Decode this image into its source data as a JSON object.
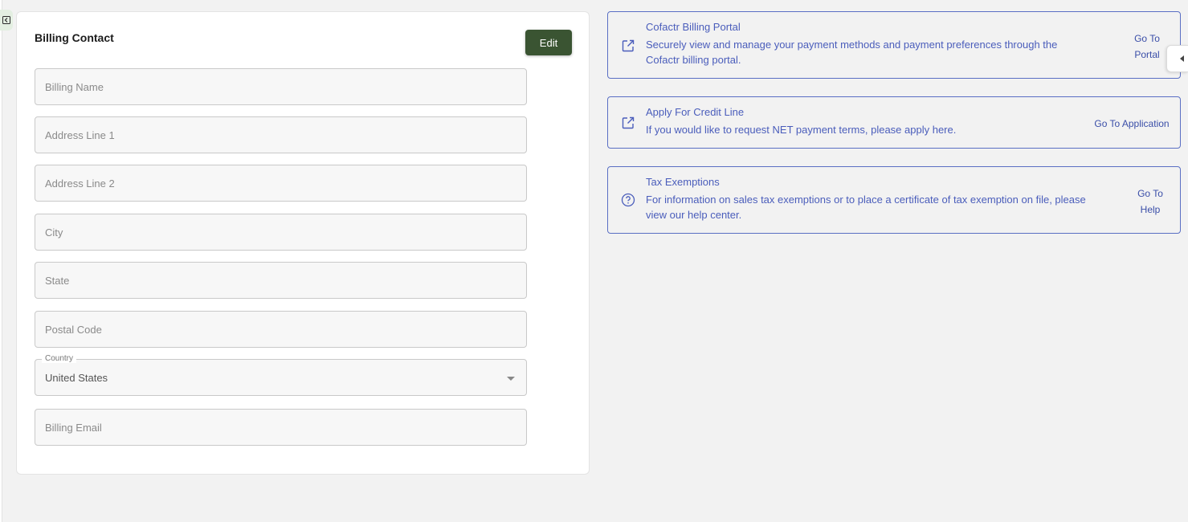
{
  "billing_contact": {
    "title": "Billing Contact",
    "edit_label": "Edit",
    "fields": {
      "billing_name": {
        "placeholder": "Billing Name",
        "value": ""
      },
      "address_line_1": {
        "placeholder": "Address Line 1",
        "value": ""
      },
      "address_line_2": {
        "placeholder": "Address Line 2",
        "value": ""
      },
      "city": {
        "placeholder": "City",
        "value": ""
      },
      "state": {
        "placeholder": "State",
        "value": ""
      },
      "postal_code": {
        "placeholder": "Postal Code",
        "value": ""
      },
      "country": {
        "label": "Country",
        "value": "United States"
      },
      "billing_email": {
        "placeholder": "Billing Email",
        "value": ""
      }
    }
  },
  "info_cards": {
    "portal": {
      "icon": "external-link-icon",
      "title": "Cofactr Billing Portal",
      "desc_line_1": "Securely view and manage your payment methods and payment preferences through the",
      "desc_line_2": "Cofactr billing portal.",
      "link_line_1": "Go To",
      "link_line_2": "Portal"
    },
    "credit": {
      "icon": "external-link-icon",
      "title": "Apply For Credit Line",
      "desc_line_1": "If you would like to request NET payment terms, please apply here.",
      "link_line_1": "Go To Application"
    },
    "tax": {
      "icon": "question-circle-icon",
      "title": "Tax Exemptions",
      "desc_line_1": "For information on sales tax exemptions or to place a certificate of tax exemption on file, please",
      "desc_line_2": "view our help center.",
      "link_line_1": "Go To",
      "link_line_2": "Help"
    }
  },
  "colors": {
    "accent_green": "#3a5432",
    "link_blue": "#4a5dbb",
    "background": "#f2f2f2"
  }
}
